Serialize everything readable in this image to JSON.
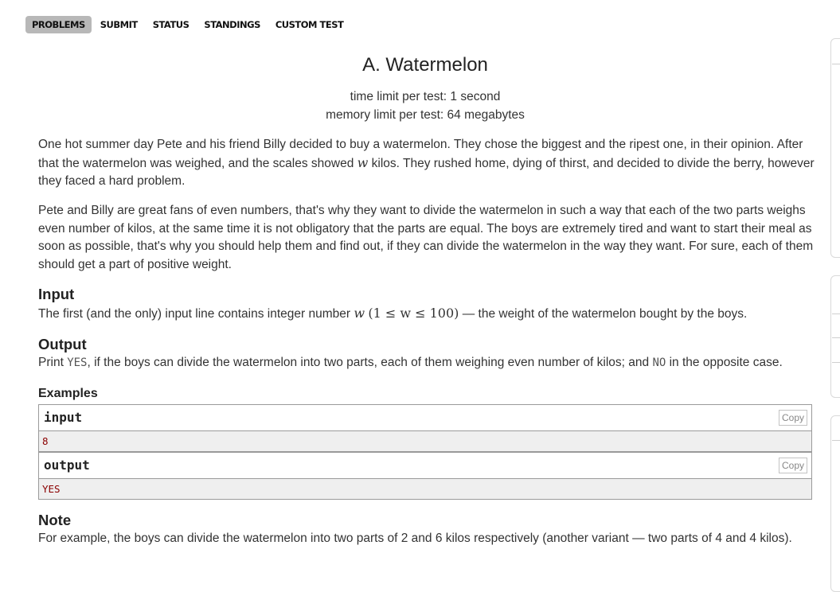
{
  "nav": {
    "items": [
      {
        "label": "PROBLEMS",
        "active": true
      },
      {
        "label": "SUBMIT",
        "active": false
      },
      {
        "label": "STATUS",
        "active": false
      },
      {
        "label": "STANDINGS",
        "active": false
      },
      {
        "label": "CUSTOM TEST",
        "active": false
      }
    ]
  },
  "problem": {
    "title": "A. Watermelon",
    "time_limit": "time limit per test: 1 second",
    "memory_limit": "memory limit per test: 64 megabytes",
    "legend_p1_a": "One hot summer day Pete and his friend Billy decided to buy a watermelon. They chose the biggest and the ripest one, in their opinion. After that the watermelon was weighed, and the scales showed ",
    "legend_p1_var": "w",
    "legend_p1_b": " kilos. They rushed home, dying of thirst, and decided to divide the berry, however they faced a hard problem.",
    "legend_p2": "Pete and Billy are great fans of even numbers, that's why they want to divide the watermelon in such a way that each of the two parts weighs even number of kilos, at the same time it is not obligatory that the parts are equal. The boys are extremely tired and want to start their meal as soon as possible, that's why you should help them and find out, if they can divide the watermelon in the way they want. For sure, each of them should get a part of positive weight.",
    "input_title": "Input",
    "input_text_a": "The first (and the only) input line contains integer number ",
    "input_var": "w",
    "input_math": "(1 ≤ w ≤ 100)",
    "input_text_b": " — the weight of the watermelon bought by the boys.",
    "output_title": "Output",
    "output_text_a": "Print ",
    "output_yes": "YES",
    "output_text_b": ", if the boys can divide the watermelon into two parts, each of them weighing even number of kilos; and ",
    "output_no": "NO",
    "output_text_c": " in the opposite case.",
    "examples_title": "Examples",
    "example_input_label": "input",
    "example_input_value": "8",
    "example_output_label": "output",
    "example_output_value": "YES",
    "copy_label": "Copy",
    "note_title": "Note",
    "note_text": "For example, the boys can divide the watermelon into two parts of 2 and 6 kilos respectively (another variant — two parts of 4 and 4 kilos)."
  }
}
